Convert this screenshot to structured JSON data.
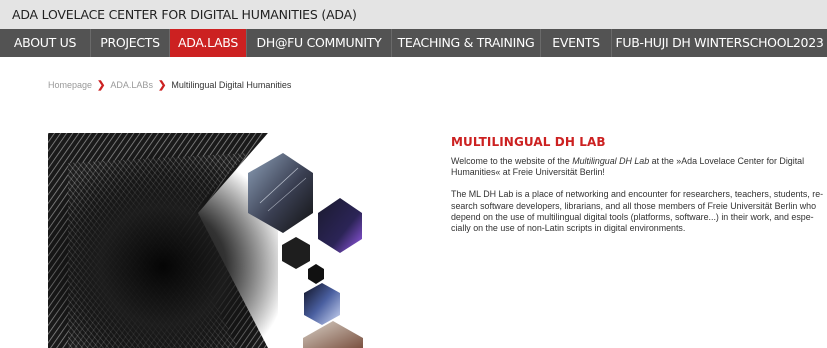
{
  "site": {
    "title": "ADA LOVELACE CENTER FOR DIGITAL HUMANITIES (ADA)"
  },
  "nav": {
    "items": [
      {
        "label": "ABOUT US",
        "active": false
      },
      {
        "label": "PROJECTS",
        "active": false
      },
      {
        "label": "ADA.LABS",
        "active": true
      },
      {
        "label": "DH@FU COMMUNITY",
        "active": false
      },
      {
        "label": "TEACHING & TRAINING",
        "active": false
      },
      {
        "label": "EVENTS",
        "active": false
      },
      {
        "label": "FUB-HUJI DH WINTERSCHOOL2023",
        "active": false
      }
    ]
  },
  "breadcrumb": {
    "items": [
      "Homepage",
      "ADA.LABs",
      "Multilingual Digital Humanities"
    ],
    "separator": "❯"
  },
  "hero": {
    "alt": "Hexagon collage of abstract light tunnel images"
  },
  "main": {
    "title": "MULTILINGUAL DH LAB",
    "intro": {
      "prefix": "Welcome to the website of the ",
      "emphasis": "Multilingual DH Lab",
      "suffix": " at the »Ada Lovelace Center for Digital Humanities« at Freie Universität Berlin!"
    },
    "paragraph2": "The ML DH Lab is a place of networking and encounter for researchers, teachers, students, re­search software developers, librarians, and all those members of Freie Universität Berlin who de­pend on the use of multilingual digital tools (platforms, software...) in their work, and espe­cially on the use of non-Latin scripts in digital environments."
  },
  "colors": {
    "accent": "#cc2121",
    "nav_bg": "#535353",
    "topbar_bg": "#e4e4e4"
  }
}
